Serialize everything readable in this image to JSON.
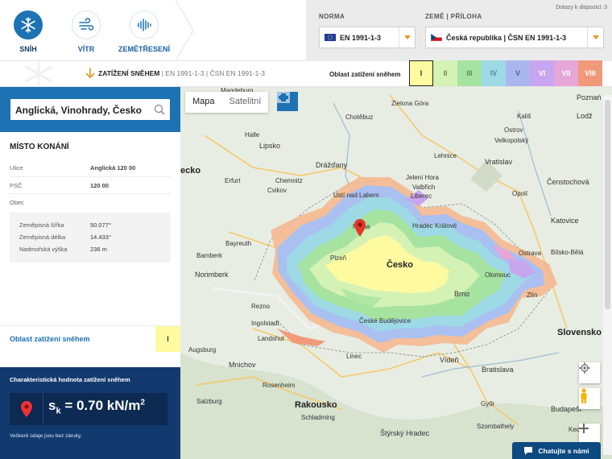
{
  "modes": [
    {
      "label": "SNÍH",
      "icon": "snowflake-icon",
      "active": true
    },
    {
      "label": "VÍTR",
      "icon": "wind-icon",
      "active": false
    },
    {
      "label": "ZEMĚTŘESENÍ",
      "icon": "seismic-wave-icon",
      "active": false
    }
  ],
  "norma": {
    "label": "NORMA",
    "value": "EN 1991-1-3"
  },
  "country": {
    "label": "ZEMĚ | PŘÍLOHA",
    "value": "Česká republika | ČSN EN 1991-1-3"
  },
  "credits": "Dotazy k dispozici: 3",
  "strip": {
    "title": "ZATÍŽENÍ SNĚHEM",
    "norm1": "EN 1991-1-3",
    "norm2": "ČSN EN 1991-1-3"
  },
  "zones": {
    "label": "Oblast zatížení sněhem",
    "items": [
      {
        "label": "I",
        "color": "#fdfaa0",
        "text": "#333"
      },
      {
        "label": "II",
        "color": "#d5f2b5",
        "text": "#6b8a58"
      },
      {
        "label": "III",
        "color": "#a6e3a0",
        "text": "#5b8c59"
      },
      {
        "label": "IV",
        "color": "#9ed9e6",
        "text": "#5a8590"
      },
      {
        "label": "V",
        "color": "#aab7ef",
        "text": "#5461a0"
      },
      {
        "label": "VI",
        "color": "#c7a6ef",
        "text": "#ffffff"
      },
      {
        "label": "VII",
        "color": "#e6a6d8",
        "text": "#ffffff"
      },
      {
        "label": "VIII",
        "color": "#f09a7a",
        "text": "#ffffff"
      }
    ]
  },
  "search": {
    "value": "Anglická, Vinohrady, Česko"
  },
  "place": {
    "title": "MÍSTO KONÁNÍ",
    "rows": [
      {
        "k": "Ulice",
        "v": "Anglická 120 00"
      },
      {
        "k": "PSČ",
        "v": "120 00"
      },
      {
        "k": "Obec",
        "v": ""
      }
    ],
    "coords": [
      {
        "k": "Zeměpisná šířka",
        "v": "50.077°"
      },
      {
        "k": "Zeměpisná délka",
        "v": "14.433°"
      },
      {
        "k": "Nadmořská výška",
        "v": "236 m"
      }
    ]
  },
  "zone_result": {
    "label": "Oblast zatížení sněhem",
    "value": "I"
  },
  "characteristic": {
    "title": "Charakteristická hodnota zatížení sněhem",
    "symbol": "s",
    "subscript": "k",
    "equals": " = 0.70 kN/m",
    "exponent": "2",
    "disclaimer": "Veškeré údaje jsou bez záruky."
  },
  "map": {
    "toggle": {
      "map": "Mapa",
      "satellite": "Satelitní"
    },
    "cities": [
      {
        "name": "Magdeburg",
        "cls": ""
      },
      {
        "name": "Zielona Góra",
        "cls": ""
      },
      {
        "name": "Poznań",
        "cls": "mid"
      },
      {
        "name": "Chotěbuz",
        "cls": ""
      },
      {
        "name": "Lodž",
        "cls": "mid"
      },
      {
        "name": "Halle",
        "cls": ""
      },
      {
        "name": "Kališ",
        "cls": ""
      },
      {
        "name": "Ostrov",
        "cls": ""
      },
      {
        "name": "Velkopolský",
        "cls": ""
      },
      {
        "name": "Lipsko",
        "cls": "mid"
      },
      {
        "name": "Lehnice",
        "cls": ""
      },
      {
        "name": "Vratislav",
        "cls": "mid"
      },
      {
        "name": "Drážďany",
        "cls": "mid"
      },
      {
        "name": "Jelení Hora",
        "cls": ""
      },
      {
        "name": "Erfurt",
        "cls": ""
      },
      {
        "name": "Chemnitz",
        "cls": ""
      },
      {
        "name": "Valbřich",
        "cls": ""
      },
      {
        "name": "Opolí",
        "cls": ""
      },
      {
        "name": "Čenstochová",
        "cls": "mid"
      },
      {
        "name": "Cvikov",
        "cls": ""
      },
      {
        "name": "Liberec",
        "cls": ""
      },
      {
        "name": "Ústí nad Labem",
        "cls": ""
      },
      {
        "name": "Hradec Králové",
        "cls": ""
      },
      {
        "name": "Katovice",
        "cls": "mid"
      },
      {
        "name": "Praha",
        "cls": ""
      },
      {
        "name": "Bayreuth",
        "cls": ""
      },
      {
        "name": "Plzeň",
        "cls": ""
      },
      {
        "name": "Česko",
        "cls": "big"
      },
      {
        "name": "Ostrava",
        "cls": ""
      },
      {
        "name": "Bílsko-Bělá",
        "cls": ""
      },
      {
        "name": "Bamberk",
        "cls": ""
      },
      {
        "name": "Olomouc",
        "cls": ""
      },
      {
        "name": "Norimberk",
        "cls": "mid"
      },
      {
        "name": "Brno",
        "cls": "mid"
      },
      {
        "name": "Zlín",
        "cls": ""
      },
      {
        "name": "Rezno",
        "cls": ""
      },
      {
        "name": "Ingolstadt",
        "cls": ""
      },
      {
        "name": "České Budějovice",
        "cls": ""
      },
      {
        "name": "Slovensko",
        "cls": "big"
      },
      {
        "name": "Landshut",
        "cls": ""
      },
      {
        "name": "Linec",
        "cls": ""
      },
      {
        "name": "Augsburg",
        "cls": ""
      },
      {
        "name": "Vídeň",
        "cls": "mid"
      },
      {
        "name": "Mnichov",
        "cls": "mid"
      },
      {
        "name": "Bratislava",
        "cls": "mid"
      },
      {
        "name": "Rosenheim",
        "cls": ""
      },
      {
        "name": "Rakousko",
        "cls": "big"
      },
      {
        "name": "Salzburg",
        "cls": ""
      },
      {
        "name": "Győr",
        "cls": ""
      },
      {
        "name": "Budapešť",
        "cls": "mid"
      },
      {
        "name": "Schladming",
        "cls": ""
      },
      {
        "name": "Štýrský Hradec",
        "cls": "mid"
      },
      {
        "name": "Szombathely",
        "cls": ""
      },
      {
        "name": "Kecsk",
        "cls": ""
      },
      {
        "name": "ecko",
        "cls": "big"
      }
    ]
  },
  "chat": "Chatujte s námi"
}
